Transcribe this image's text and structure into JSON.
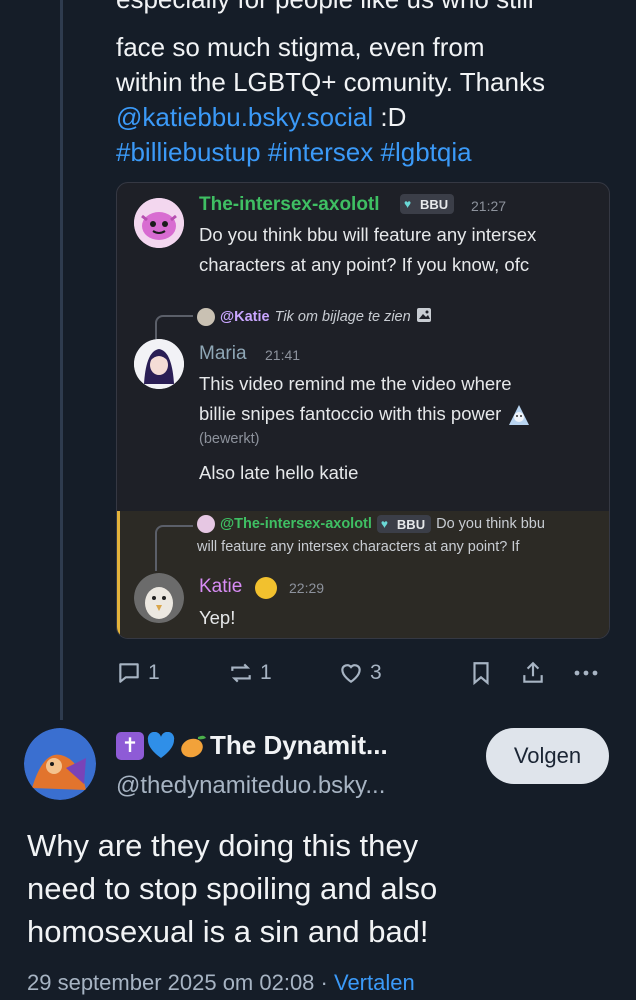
{
  "post": {
    "clipped_line": "especially for people like us who still",
    "lines": [
      "face so much stigma, even from",
      "within the LGBTQ+ comunity. Thanks"
    ],
    "mention": "@katiebbu.bsky.social",
    "mention_suffix": " :D",
    "hashtags": "#billiebustup #intersex #lgbtqia"
  },
  "embed": {
    "msg1": {
      "name": "The-intersex-axolotl",
      "name_color": "#3fbf63",
      "tag": "BBU",
      "time": "21:27",
      "lines": [
        "Do you think bbu will feature any intersex",
        "characters at any point? If you know, ofc"
      ]
    },
    "msg2": {
      "reply_mention": "@Katie",
      "reply_text": "Tik om bijlage te zien",
      "name": "Maria",
      "name_color": "#8fa7b6",
      "time": "21:41",
      "lines": [
        "This video remind me the video where",
        "billie snipes fantoccio with this power"
      ],
      "edited": "(bewerkt)",
      "extra": "Also late hello katie"
    },
    "msg3": {
      "reply_mention": "@The-intersex-axolotl",
      "reply_tag": "BBU",
      "reply_text_1": "Do you think bbu",
      "reply_text_2": "will feature any intersex characters at any point? If",
      "name": "Katie",
      "name_color": "#d88cf5",
      "time": "22:29",
      "text": "Yep!"
    }
  },
  "actions": {
    "replies": "1",
    "reposts": "1",
    "likes": "3"
  },
  "reply": {
    "display_name": "The Dynamit...",
    "emojis": [
      "cross-icon",
      "blue-heart-icon",
      "mango-icon"
    ],
    "handle": "@thedynamiteduo.bsky...",
    "follow_label": "Volgen",
    "lines": [
      "Why are they doing this they",
      "need to stop spoiling and also",
      "homosexual is a sin and bad!"
    ],
    "date": "29 september 2025 om 02:08",
    "separator": " · ",
    "translate": "Vertalen"
  },
  "colors": {
    "link": "#3b9af8",
    "background": "#151d28",
    "highlight_bar": "#e3b33b"
  }
}
